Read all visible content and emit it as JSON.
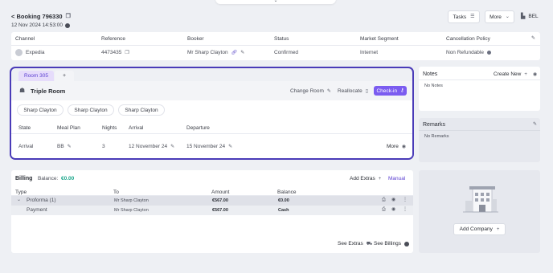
{
  "header": {
    "back_label": "< Booking 796330",
    "date": "12 Nov 2024 14:53:00",
    "tasks_label": "Tasks",
    "more_label": "More",
    "lang": "BEL"
  },
  "booking_table": {
    "headers": [
      "Channel",
      "Reference",
      "Booker",
      "Status",
      "Market Segment",
      "Cancellation Policy"
    ],
    "channel": "Expedia",
    "reference": "4473435",
    "booker": "Mr Sharp Clayton",
    "status": "Confirmed",
    "market_segment": "Internet",
    "cancellation_policy": "Non Refundable"
  },
  "room": {
    "tab_label": "Room 305",
    "tab_add": "+",
    "type": "Triple Room",
    "change_room": "Change Room",
    "reallocate": "Reallocate",
    "check_in": "Check-in",
    "guests": [
      "Sharp Clayton",
      "Sharp Clayton",
      "Sharp Clayton"
    ],
    "headers": [
      "State",
      "Meal Plan",
      "Nights",
      "Arrival",
      "Departure"
    ],
    "state": "Arrival",
    "meal_plan": "BB",
    "nights": "3",
    "arrival": "12 November 24",
    "departure": "15 November 24",
    "more": "More"
  },
  "notes": {
    "title": "Notes",
    "create_new": "Create New",
    "empty": "No Notes"
  },
  "remarks": {
    "title": "Remarks",
    "empty": "No Remarks"
  },
  "billing": {
    "title": "Billing",
    "balance_label": "Balance:",
    "balance_value": "€0.00",
    "add_extras": "Add Extras",
    "manual": "Manual",
    "headers": [
      "Type",
      "To",
      "Amount",
      "Balance"
    ],
    "rows": [
      {
        "type": "Proforma (1)",
        "to": "Mr Sharp Clayton",
        "amount": "€567.00",
        "balance": "€0.00"
      },
      {
        "type": "Payment",
        "to": "Mr Sharp Clayton",
        "amount": "€567.00",
        "balance": "Cash"
      }
    ],
    "see_extras": "See Extras",
    "see_billings": "See Billings"
  },
  "company": {
    "add_label": "Add Company"
  },
  "colors": {
    "accent": "#7b5cf0",
    "focus_border": "#4a3bb8",
    "balance_green": "#17a589"
  }
}
